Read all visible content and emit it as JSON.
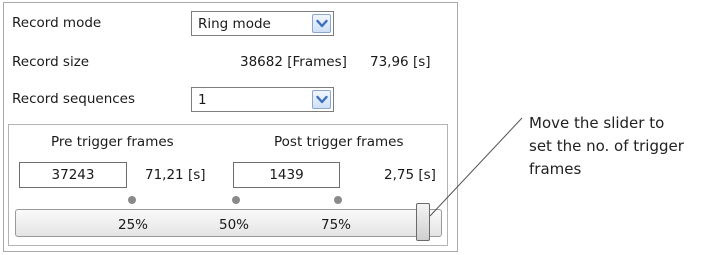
{
  "panel": {
    "record_mode_label": "Record mode",
    "record_mode_value": "Ring mode",
    "record_size_label": "Record size",
    "record_size_frames": "38682 [Frames]",
    "record_size_seconds": "73,96 [s]",
    "record_sequences_label": "Record sequences",
    "record_sequences_value": "1",
    "icons": {
      "dropdown": "chevron-down-icon"
    },
    "accent_color": "#3a6fc1"
  },
  "trigger": {
    "pre_label": "Pre trigger frames",
    "post_label": "Post trigger frames",
    "pre_frames": "37243",
    "pre_seconds": "71,21 [s]",
    "post_frames": "1439",
    "post_seconds": "2,75 [s]",
    "slider": {
      "tick_25": "25%",
      "tick_50": "50%",
      "tick_75": "75%",
      "value_percent": 96
    }
  },
  "annotation": {
    "line1": "Move the slider to",
    "line2": "set the no. of trigger",
    "line3": "frames"
  }
}
